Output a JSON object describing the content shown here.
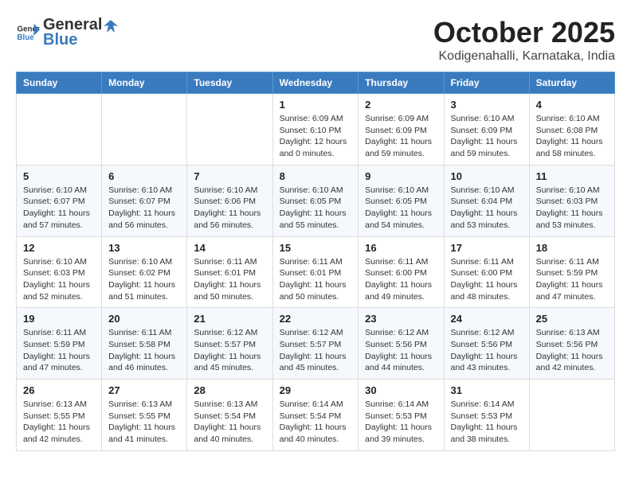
{
  "logo": {
    "text_general": "General",
    "text_blue": "Blue"
  },
  "title": "October 2025",
  "subtitle": "Kodigenahalli, Karnataka, India",
  "weekdays": [
    "Sunday",
    "Monday",
    "Tuesday",
    "Wednesday",
    "Thursday",
    "Friday",
    "Saturday"
  ],
  "weeks": [
    [
      {
        "day": "",
        "info": ""
      },
      {
        "day": "",
        "info": ""
      },
      {
        "day": "",
        "info": ""
      },
      {
        "day": "1",
        "info": "Sunrise: 6:09 AM\nSunset: 6:10 PM\nDaylight: 12 hours\nand 0 minutes."
      },
      {
        "day": "2",
        "info": "Sunrise: 6:09 AM\nSunset: 6:09 PM\nDaylight: 11 hours\nand 59 minutes."
      },
      {
        "day": "3",
        "info": "Sunrise: 6:10 AM\nSunset: 6:09 PM\nDaylight: 11 hours\nand 59 minutes."
      },
      {
        "day": "4",
        "info": "Sunrise: 6:10 AM\nSunset: 6:08 PM\nDaylight: 11 hours\nand 58 minutes."
      }
    ],
    [
      {
        "day": "5",
        "info": "Sunrise: 6:10 AM\nSunset: 6:07 PM\nDaylight: 11 hours\nand 57 minutes."
      },
      {
        "day": "6",
        "info": "Sunrise: 6:10 AM\nSunset: 6:07 PM\nDaylight: 11 hours\nand 56 minutes."
      },
      {
        "day": "7",
        "info": "Sunrise: 6:10 AM\nSunset: 6:06 PM\nDaylight: 11 hours\nand 56 minutes."
      },
      {
        "day": "8",
        "info": "Sunrise: 6:10 AM\nSunset: 6:05 PM\nDaylight: 11 hours\nand 55 minutes."
      },
      {
        "day": "9",
        "info": "Sunrise: 6:10 AM\nSunset: 6:05 PM\nDaylight: 11 hours\nand 54 minutes."
      },
      {
        "day": "10",
        "info": "Sunrise: 6:10 AM\nSunset: 6:04 PM\nDaylight: 11 hours\nand 53 minutes."
      },
      {
        "day": "11",
        "info": "Sunrise: 6:10 AM\nSunset: 6:03 PM\nDaylight: 11 hours\nand 53 minutes."
      }
    ],
    [
      {
        "day": "12",
        "info": "Sunrise: 6:10 AM\nSunset: 6:03 PM\nDaylight: 11 hours\nand 52 minutes."
      },
      {
        "day": "13",
        "info": "Sunrise: 6:10 AM\nSunset: 6:02 PM\nDaylight: 11 hours\nand 51 minutes."
      },
      {
        "day": "14",
        "info": "Sunrise: 6:11 AM\nSunset: 6:01 PM\nDaylight: 11 hours\nand 50 minutes."
      },
      {
        "day": "15",
        "info": "Sunrise: 6:11 AM\nSunset: 6:01 PM\nDaylight: 11 hours\nand 50 minutes."
      },
      {
        "day": "16",
        "info": "Sunrise: 6:11 AM\nSunset: 6:00 PM\nDaylight: 11 hours\nand 49 minutes."
      },
      {
        "day": "17",
        "info": "Sunrise: 6:11 AM\nSunset: 6:00 PM\nDaylight: 11 hours\nand 48 minutes."
      },
      {
        "day": "18",
        "info": "Sunrise: 6:11 AM\nSunset: 5:59 PM\nDaylight: 11 hours\nand 47 minutes."
      }
    ],
    [
      {
        "day": "19",
        "info": "Sunrise: 6:11 AM\nSunset: 5:59 PM\nDaylight: 11 hours\nand 47 minutes."
      },
      {
        "day": "20",
        "info": "Sunrise: 6:11 AM\nSunset: 5:58 PM\nDaylight: 11 hours\nand 46 minutes."
      },
      {
        "day": "21",
        "info": "Sunrise: 6:12 AM\nSunset: 5:57 PM\nDaylight: 11 hours\nand 45 minutes."
      },
      {
        "day": "22",
        "info": "Sunrise: 6:12 AM\nSunset: 5:57 PM\nDaylight: 11 hours\nand 45 minutes."
      },
      {
        "day": "23",
        "info": "Sunrise: 6:12 AM\nSunset: 5:56 PM\nDaylight: 11 hours\nand 44 minutes."
      },
      {
        "day": "24",
        "info": "Sunrise: 6:12 AM\nSunset: 5:56 PM\nDaylight: 11 hours\nand 43 minutes."
      },
      {
        "day": "25",
        "info": "Sunrise: 6:13 AM\nSunset: 5:56 PM\nDaylight: 11 hours\nand 42 minutes."
      }
    ],
    [
      {
        "day": "26",
        "info": "Sunrise: 6:13 AM\nSunset: 5:55 PM\nDaylight: 11 hours\nand 42 minutes."
      },
      {
        "day": "27",
        "info": "Sunrise: 6:13 AM\nSunset: 5:55 PM\nDaylight: 11 hours\nand 41 minutes."
      },
      {
        "day": "28",
        "info": "Sunrise: 6:13 AM\nSunset: 5:54 PM\nDaylight: 11 hours\nand 40 minutes."
      },
      {
        "day": "29",
        "info": "Sunrise: 6:14 AM\nSunset: 5:54 PM\nDaylight: 11 hours\nand 40 minutes."
      },
      {
        "day": "30",
        "info": "Sunrise: 6:14 AM\nSunset: 5:53 PM\nDaylight: 11 hours\nand 39 minutes."
      },
      {
        "day": "31",
        "info": "Sunrise: 6:14 AM\nSunset: 5:53 PM\nDaylight: 11 hours\nand 38 minutes."
      },
      {
        "day": "",
        "info": ""
      }
    ]
  ]
}
